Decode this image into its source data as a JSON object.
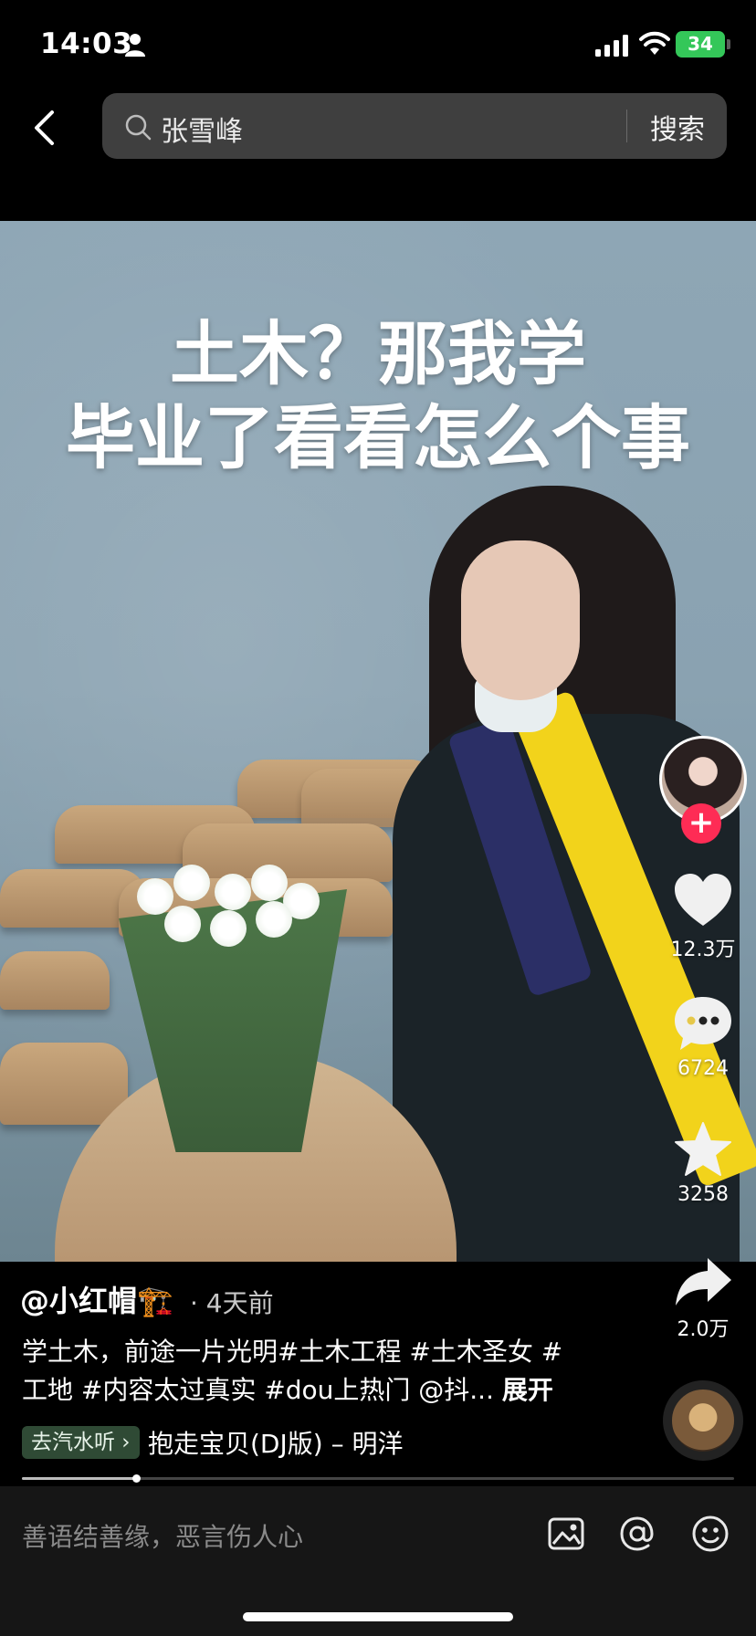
{
  "status_bar": {
    "time": "14:03",
    "battery": "34",
    "icons": [
      "person-icon",
      "signal-icon",
      "wifi-icon",
      "battery-icon"
    ]
  },
  "search": {
    "query": "张雪峰",
    "button_label": "搜索",
    "icon": "search-icon"
  },
  "video": {
    "overlay_title_line1": "土木？那我学",
    "overlay_title_line2": "毕业了看看怎么个事"
  },
  "actions": {
    "likes": "12.3万",
    "comments": "6724",
    "favorites": "3258",
    "shares": "2.0万",
    "follow_label": "+"
  },
  "post": {
    "author": "@小红帽🏗️",
    "time_ago": "· 4天前",
    "caption": "学土木，前途一片光明#土木工程 #土木圣女 #工地 #内容太过真实 #dou上热门 @抖...",
    "expand_label": "展开",
    "music_badge": "去汽水听 ›",
    "music_title": "抱走宝贝(DJ版) – 明洋",
    "progress_fraction": 0.16
  },
  "comment_bar": {
    "placeholder": "善语结善缘，恶言伤人心",
    "icons": [
      "image-icon",
      "at-icon",
      "emoji-icon"
    ]
  },
  "colors": {
    "accent_red": "#fe2c55",
    "battery_green": "#34c759",
    "music_badge_bg": "#2f4a35"
  }
}
